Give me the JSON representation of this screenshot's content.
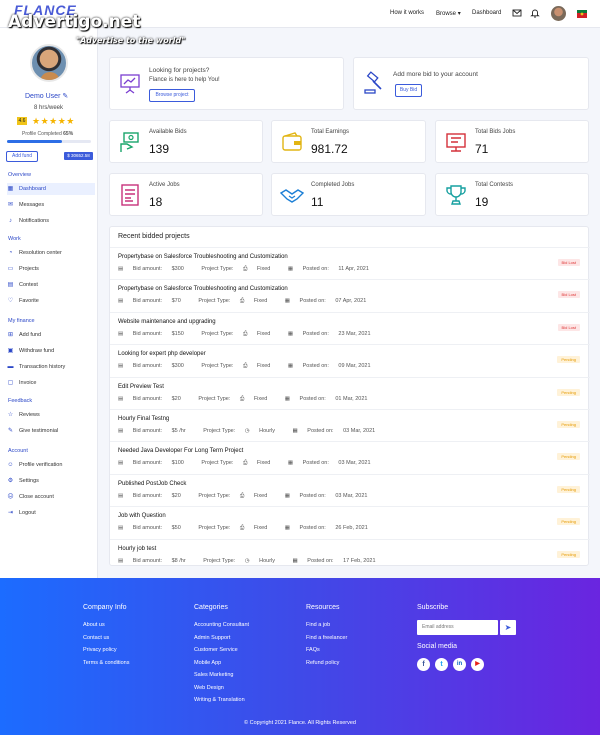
{
  "header": {
    "logo": "FLANCE",
    "watermark": "Advertigo.net",
    "watermark_tagline": "\"Advertise to the world\"",
    "nav": [
      "How it works",
      "Browse",
      "Dashboard"
    ]
  },
  "sidebar": {
    "user_name": "Demo User",
    "hours": "8 hrs/week",
    "rating": "4.6",
    "stars": "★★★★★",
    "profile_completed_label": "Profile Completed",
    "profile_completed_value": "65%",
    "profile_progress": 0.65,
    "add_fund": "Add fund",
    "balance": "$ 30652.58",
    "sections": [
      {
        "title": "Overview",
        "items": [
          {
            "label": "Dashboard",
            "icon": "dashboard-icon"
          },
          {
            "label": "Messages",
            "icon": "mail-icon"
          },
          {
            "label": "Notifications",
            "icon": "bell-icon"
          }
        ]
      },
      {
        "title": "Work",
        "items": [
          {
            "label": "Resolution center",
            "icon": "chat-icon"
          },
          {
            "label": "Projects",
            "icon": "folder-icon"
          },
          {
            "label": "Contest",
            "icon": "file-icon"
          },
          {
            "label": "Favorite",
            "icon": "heart-icon"
          }
        ]
      },
      {
        "title": "My finance",
        "items": [
          {
            "label": "Add fund",
            "icon": "plus-card-icon"
          },
          {
            "label": "Withdraw fund",
            "icon": "wallet-icon"
          },
          {
            "label": "Transaction history",
            "icon": "card-icon"
          },
          {
            "label": "Invoice",
            "icon": "invoice-icon"
          }
        ]
      },
      {
        "title": "Feedback",
        "items": [
          {
            "label": "Reviews",
            "icon": "star-icon"
          },
          {
            "label": "Give testimonial",
            "icon": "edit-icon"
          }
        ]
      },
      {
        "title": "Account",
        "items": [
          {
            "label": "Profile verification",
            "icon": "user-check-icon"
          },
          {
            "label": "Settings",
            "icon": "gear-icon"
          },
          {
            "label": "Close account",
            "icon": "user-x-icon"
          },
          {
            "label": "Logout",
            "icon": "logout-icon"
          }
        ]
      }
    ]
  },
  "promo": [
    {
      "title": "Looking for projects?",
      "subtitle": "Flance is here to help You!",
      "button": "Browse project",
      "icon": "presentation-icon"
    },
    {
      "title": "Add more bid to your account",
      "button": "Buy Bid",
      "icon": "gavel-icon"
    }
  ],
  "stats": [
    {
      "label": "Available Bids",
      "value": "139",
      "icon": "hand-money-icon",
      "color": "#1aa56b"
    },
    {
      "label": "Total Earnings",
      "value": "981.72",
      "icon": "wallet-icon",
      "color": "#e2b514"
    },
    {
      "label": "Total Bids Jobs",
      "value": "71",
      "icon": "monitor-icon",
      "color": "#d4303a"
    },
    {
      "label": "Active Jobs",
      "value": "18",
      "icon": "document-icon",
      "color": "#c8327c"
    },
    {
      "label": "Completed Jobs",
      "value": "11",
      "icon": "handshake-icon",
      "color": "#1c7fd6"
    },
    {
      "label": "Total Contests",
      "value": "19",
      "icon": "trophy-icon",
      "color": "#17a0a0"
    }
  ],
  "recent": {
    "title": "Recent bidded projects",
    "bid_label": "Bid amount:",
    "type_label": "Project Type:",
    "posted_label": "Posted on:",
    "rows": [
      {
        "title": "Propertybase on Salesforce Troubleshooting and Customization",
        "bid": "$300",
        "type": "Fixed",
        "posted": "11 Apr, 2021",
        "status": "Bid Lost"
      },
      {
        "title": "Propertybase on Salesforce Troubleshooting and Customization",
        "bid": "$70",
        "type": "Fixed",
        "posted": "07 Apr, 2021",
        "status": "Bid Lost"
      },
      {
        "title": "Website maintenance and upgrading",
        "bid": "$150",
        "type": "Fixed",
        "posted": "23 Mar, 2021",
        "status": "Bid Lost"
      },
      {
        "title": "Looking for expert php developer",
        "bid": "$300",
        "type": "Fixed",
        "posted": "09 Mar, 2021",
        "status": "Pending"
      },
      {
        "title": "Edit Preview Test",
        "bid": "$20",
        "type": "Fixed",
        "posted": "01 Mar, 2021",
        "status": "Pending"
      },
      {
        "title": "Hourly Final Testng",
        "bid": "$5 /hr",
        "type": "Hourly",
        "posted": "03 Mar, 2021",
        "status": "Pending"
      },
      {
        "title": "Needed Java Developer For Long Term Project",
        "bid": "$100",
        "type": "Fixed",
        "posted": "03 Mar, 2021",
        "status": "Pending"
      },
      {
        "title": "Published PostJob Check",
        "bid": "$20",
        "type": "Fixed",
        "posted": "03 Mar, 2021",
        "status": "Pending"
      },
      {
        "title": "Job with Question",
        "bid": "$50",
        "type": "Fixed",
        "posted": "26 Feb, 2021",
        "status": "Pending"
      },
      {
        "title": "Hourly job test",
        "bid": "$8 /hr",
        "type": "Hourly",
        "posted": "17 Feb, 2021",
        "status": "Pending"
      }
    ]
  },
  "footer": {
    "columns": [
      {
        "title": "Company Info",
        "links": [
          "About us",
          "Contact us",
          "Privacy policy",
          "Terms & conditions"
        ]
      },
      {
        "title": "Categories",
        "links": [
          "Accounting Consultant",
          "Admin Support",
          "Customer Service",
          "Mobile App",
          "Sales Marketing",
          "Web Design",
          "Writing & Translation"
        ]
      },
      {
        "title": "Resources",
        "links": [
          "Find a job",
          "Find a freelancer",
          "FAQs",
          "Refund policy"
        ]
      }
    ],
    "subscribe_title": "Subscribe",
    "email_placeholder": "Email address",
    "social_title": "Social media",
    "social": [
      "f",
      "t",
      "in",
      "▶"
    ],
    "copyright": "© Copyright 2021 Flance. All Rights Reserved"
  }
}
